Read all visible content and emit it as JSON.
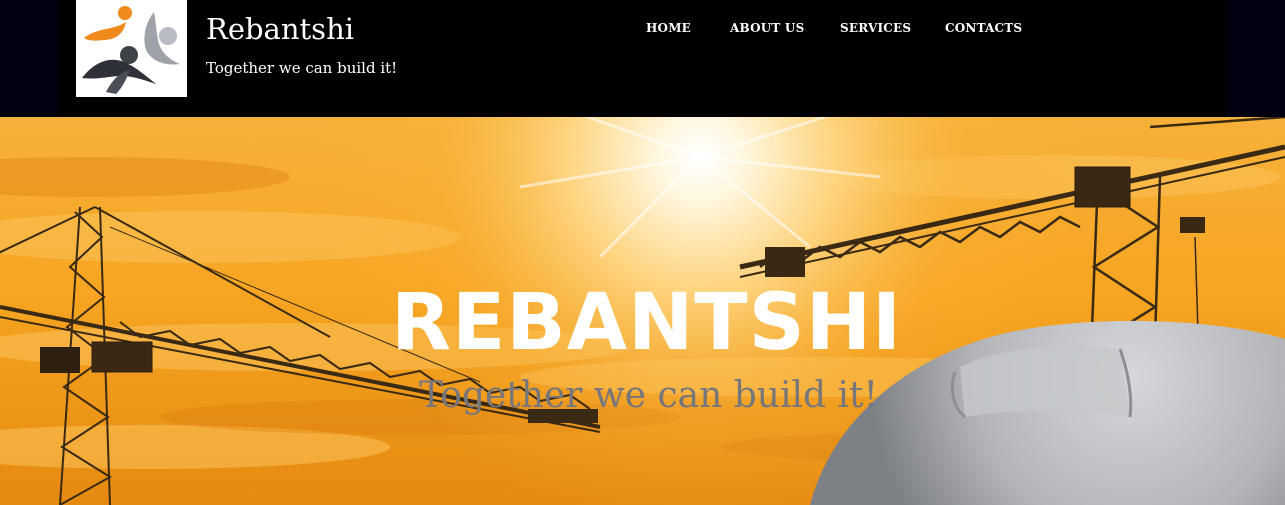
{
  "header": {
    "site_title": "Rebantshi",
    "tagline": "Together we can build it!",
    "logo_icon": "people-logo-icon",
    "background": "#000000"
  },
  "nav": {
    "items": [
      {
        "label": "HOME"
      },
      {
        "label": "ABOUT US"
      },
      {
        "label": "SERVICES"
      },
      {
        "label": "CONTACTS"
      }
    ]
  },
  "hero": {
    "title": "REBANTSHI",
    "subtitle": "Together we can build it!",
    "image_icon": "construction-cranes-sunset-image",
    "accent": "#f5a623"
  }
}
